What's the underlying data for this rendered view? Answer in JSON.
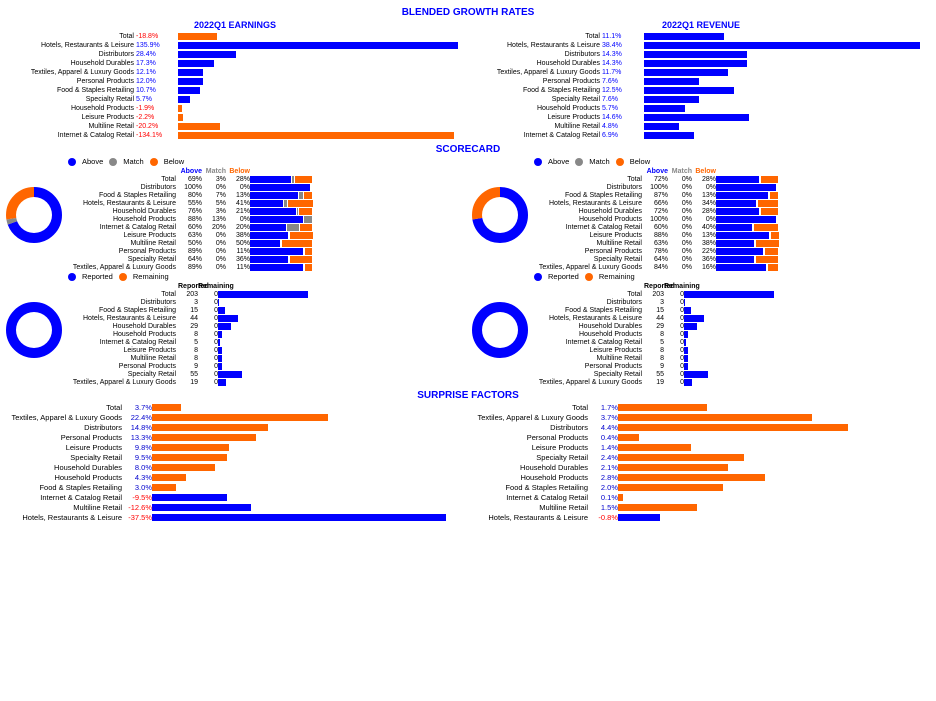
{
  "titles": {
    "blended_growth": "BLENDED GROWTH RATES",
    "earnings_title": "2022Q1 EARNINGS",
    "revenue_title": "2022Q1 REVENUE",
    "scorecard": "SCORECARD",
    "surprise": "SURPRISE FACTORS"
  },
  "earnings": {
    "rows": [
      {
        "label": "Total",
        "val": "-18.8%",
        "v": -18.8,
        "neg": true
      },
      {
        "label": "Hotels, Restaurants & Leisure",
        "val": "135.9%",
        "v": 135.9,
        "neg": false
      },
      {
        "label": "Distributors",
        "val": "28.4%",
        "v": 28.4,
        "neg": false
      },
      {
        "label": "Household Durables",
        "val": "17.3%",
        "v": 17.3,
        "neg": false
      },
      {
        "label": "Textiles, Apparel & Luxury Goods",
        "val": "12.1%",
        "v": 12.1,
        "neg": false
      },
      {
        "label": "Personal Products",
        "val": "12.0%",
        "v": 12.0,
        "neg": false
      },
      {
        "label": "Food & Staples Retailing",
        "val": "10.7%",
        "v": 10.7,
        "neg": false
      },
      {
        "label": "Specialty Retail",
        "val": "5.7%",
        "v": 5.7,
        "neg": false
      },
      {
        "label": "Household Products",
        "val": "-1.9%",
        "v": -1.9,
        "neg": true
      },
      {
        "label": "Leisure Products",
        "val": "-2.2%",
        "v": -2.2,
        "neg": true
      },
      {
        "label": "Multiline Retail",
        "val": "-20.2%",
        "v": -20.2,
        "neg": true
      },
      {
        "label": "Internet & Catalog Retail",
        "val": "-134.1%",
        "v": -134.1,
        "neg": true
      }
    ]
  },
  "revenue": {
    "rows": [
      {
        "label": "Total",
        "val": "11.1%",
        "v": 11.1
      },
      {
        "label": "Hotels, Restaurants & Leisure",
        "val": "38.4%",
        "v": 38.4
      },
      {
        "label": "Distributors",
        "val": "14.3%",
        "v": 14.3
      },
      {
        "label": "Household Durables",
        "val": "14.3%",
        "v": 14.3
      },
      {
        "label": "Textiles, Apparel & Luxury Goods",
        "val": "11.7%",
        "v": 11.7
      },
      {
        "label": "Personal Products",
        "val": "7.6%",
        "v": 7.6
      },
      {
        "label": "Food & Staples Retailing",
        "val": "12.5%",
        "v": 12.5
      },
      {
        "label": "Specialty Retail",
        "val": "7.6%",
        "v": 7.6
      },
      {
        "label": "Household Products",
        "val": "5.7%",
        "v": 5.7
      },
      {
        "label": "Leisure Products",
        "val": "14.6%",
        "v": 14.6
      },
      {
        "label": "Multiline Retail",
        "val": "4.8%",
        "v": 4.8
      },
      {
        "label": "Internet & Catalog Retail",
        "val": "6.9%",
        "v": 6.9
      }
    ]
  },
  "scorecard_left": {
    "legend": [
      "Above",
      "Match",
      "Below"
    ],
    "header": {
      "above": "Above",
      "match": "Match",
      "below": "Below"
    },
    "total_above": 69,
    "total_match": 3,
    "total_below": 28,
    "rows": [
      {
        "label": "Total",
        "above": 69,
        "match": 3,
        "below": 28
      },
      {
        "label": "Distributors",
        "above": 100,
        "match": 0,
        "below": 0
      },
      {
        "label": "Food & Staples Retailing",
        "above": 80,
        "match": 7,
        "below": 13
      },
      {
        "label": "Hotels, Restaurants & Leisure",
        "above": 55,
        "match": 5,
        "below": 41
      },
      {
        "label": "Household Durables",
        "above": 76,
        "match": 3,
        "below": 21
      },
      {
        "label": "Household Products",
        "above": 88,
        "match": 13,
        "below": 0
      },
      {
        "label": "Internet & Catalog Retail",
        "above": 60,
        "match": 20,
        "below": 20
      },
      {
        "label": "Leisure Products",
        "above": 63,
        "match": 0,
        "below": 38
      },
      {
        "label": "Multiline Retail",
        "above": 50,
        "match": 0,
        "below": 50
      },
      {
        "label": "Personal Products",
        "above": 89,
        "match": 0,
        "below": 11
      },
      {
        "label": "Specialty Retail",
        "above": 64,
        "match": 0,
        "below": 36
      },
      {
        "label": "Textiles, Apparel & Luxury Goods",
        "above": 89,
        "match": 0,
        "below": 11
      }
    ],
    "donut": {
      "above": 69,
      "match": 3,
      "below": 28
    }
  },
  "scorecard_right": {
    "total_above": 72,
    "total_match": 0,
    "total_below": 28,
    "rows": [
      {
        "label": "Total",
        "above": 72,
        "match": 0,
        "below": 28
      },
      {
        "label": "Distributors",
        "above": 100,
        "match": 0,
        "below": 0
      },
      {
        "label": "Food & Staples Retailing",
        "above": 87,
        "match": 0,
        "below": 13
      },
      {
        "label": "Hotels, Restaurants & Leisure",
        "above": 66,
        "match": 0,
        "below": 34
      },
      {
        "label": "Household Durables",
        "above": 72,
        "match": 0,
        "below": 28
      },
      {
        "label": "Household Products",
        "above": 100,
        "match": 0,
        "below": 0
      },
      {
        "label": "Internet & Catalog Retail",
        "above": 60,
        "match": 0,
        "below": 40
      },
      {
        "label": "Leisure Products",
        "above": 88,
        "match": 0,
        "below": 13
      },
      {
        "label": "Multiline Retail",
        "above": 63,
        "match": 0,
        "below": 38
      },
      {
        "label": "Personal Products",
        "above": 78,
        "match": 0,
        "below": 22
      },
      {
        "label": "Specialty Retail",
        "above": 64,
        "match": 0,
        "below": 36
      },
      {
        "label": "Textiles, Apparel & Luxury Goods",
        "above": 84,
        "match": 0,
        "below": 16
      }
    ],
    "donut": {
      "above": 72,
      "match": 0,
      "below": 28
    }
  },
  "reported_left": {
    "total": 203,
    "rows": [
      {
        "label": "Total",
        "reported": 203,
        "remaining": 0
      },
      {
        "label": "Distributors",
        "reported": 3,
        "remaining": 0
      },
      {
        "label": "Food & Staples Retailing",
        "reported": 15,
        "remaining": 0
      },
      {
        "label": "Hotels, Restaurants & Leisure",
        "reported": 44,
        "remaining": 0
      },
      {
        "label": "Household Durables",
        "reported": 29,
        "remaining": 0
      },
      {
        "label": "Household Products",
        "reported": 8,
        "remaining": 0
      },
      {
        "label": "Internet & Catalog Retail",
        "reported": 5,
        "remaining": 0
      },
      {
        "label": "Leisure Products",
        "reported": 8,
        "remaining": 0
      },
      {
        "label": "Multiline Retail",
        "reported": 8,
        "remaining": 0
      },
      {
        "label": "Personal Products",
        "reported": 9,
        "remaining": 0
      },
      {
        "label": "Specialty Retail",
        "reported": 55,
        "remaining": 0
      },
      {
        "label": "Textiles, Apparel & Luxury Goods",
        "reported": 19,
        "remaining": 0
      }
    ]
  },
  "reported_right": {
    "total": 203,
    "rows": [
      {
        "label": "Total",
        "reported": 203,
        "remaining": 0
      },
      {
        "label": "Distributors",
        "reported": 3,
        "remaining": 0
      },
      {
        "label": "Food & Staples Retailing",
        "reported": 15,
        "remaining": 0
      },
      {
        "label": "Hotels, Restaurants & Leisure",
        "reported": 44,
        "remaining": 0
      },
      {
        "label": "Household Durables",
        "reported": 29,
        "remaining": 0
      },
      {
        "label": "Household Products",
        "reported": 8,
        "remaining": 0
      },
      {
        "label": "Internet & Catalog Retail",
        "reported": 5,
        "remaining": 0
      },
      {
        "label": "Leisure Products",
        "reported": 8,
        "remaining": 0
      },
      {
        "label": "Multiline Retail",
        "reported": 8,
        "remaining": 0
      },
      {
        "label": "Personal Products",
        "reported": 9,
        "remaining": 0
      },
      {
        "label": "Specialty Retail",
        "reported": 55,
        "remaining": 0
      },
      {
        "label": "Textiles, Apparel & Luxury Goods",
        "reported": 19,
        "remaining": 0
      }
    ]
  },
  "surprise_left": {
    "rows": [
      {
        "label": "Total",
        "val": "3.7%",
        "v": 3.7
      },
      {
        "label": "Textiles, Apparel & Luxury Goods",
        "val": "22.4%",
        "v": 22.4
      },
      {
        "label": "Distributors",
        "val": "14.8%",
        "v": 14.8
      },
      {
        "label": "Personal Products",
        "val": "13.3%",
        "v": 13.3
      },
      {
        "label": "Leisure Products",
        "val": "9.8%",
        "v": 9.8
      },
      {
        "label": "Specialty Retail",
        "val": "9.5%",
        "v": 9.5
      },
      {
        "label": "Household Durables",
        "val": "8.0%",
        "v": 8.0
      },
      {
        "label": "Household Products",
        "val": "4.3%",
        "v": 4.3
      },
      {
        "label": "Food & Staples Retailing",
        "val": "3.0%",
        "v": 3.0
      },
      {
        "label": "Internet & Catalog Retail",
        "val": "-9.5%",
        "v": -9.5
      },
      {
        "label": "Multiline Retail",
        "val": "-12.6%",
        "v": -12.6
      },
      {
        "label": "Hotels, Restaurants & Leisure",
        "val": "-37.5%",
        "v": -37.5
      }
    ]
  },
  "surprise_right": {
    "rows": [
      {
        "label": "Total",
        "val": "1.7%",
        "v": 1.7
      },
      {
        "label": "Textiles, Apparel & Luxury Goods",
        "val": "3.7%",
        "v": 3.7
      },
      {
        "label": "Distributors",
        "val": "4.4%",
        "v": 4.4
      },
      {
        "label": "Personal Products",
        "val": "0.4%",
        "v": 0.4
      },
      {
        "label": "Leisure Products",
        "val": "1.4%",
        "v": 1.4
      },
      {
        "label": "Specialty Retail",
        "val": "2.4%",
        "v": 2.4
      },
      {
        "label": "Household Durables",
        "val": "2.1%",
        "v": 2.1
      },
      {
        "label": "Household Products",
        "val": "2.8%",
        "v": 2.8
      },
      {
        "label": "Food & Staples Retailing",
        "val": "2.0%",
        "v": 2.0
      },
      {
        "label": "Internet & Catalog Retail",
        "val": "0.1%",
        "v": 0.1
      },
      {
        "label": "Multiline Retail",
        "val": "1.5%",
        "v": 1.5
      },
      {
        "label": "Hotels, Restaurants & Leisure",
        "val": "-0.8%",
        "v": -0.8
      }
    ]
  }
}
